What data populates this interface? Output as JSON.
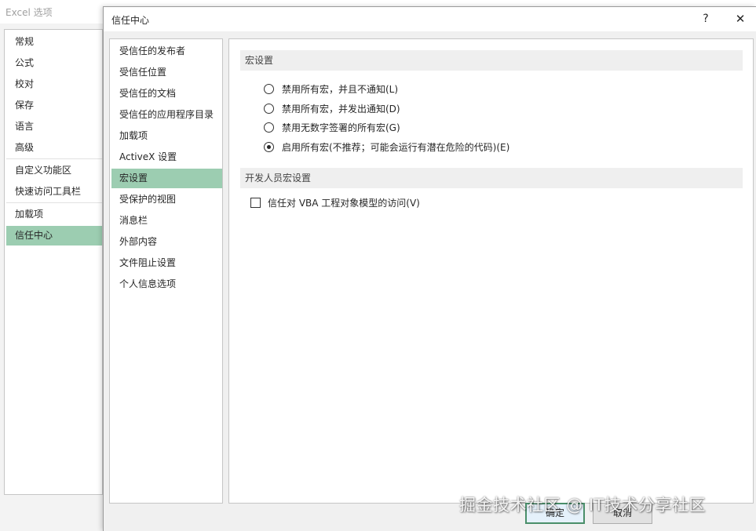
{
  "background_window": {
    "title": "Excel 选项",
    "sidebar_items": [
      {
        "label": "常规",
        "active": false
      },
      {
        "label": "公式",
        "active": false
      },
      {
        "label": "校对",
        "active": false
      },
      {
        "label": "保存",
        "active": false
      },
      {
        "label": "语言",
        "active": false
      },
      {
        "label": "高级",
        "active": false
      },
      {
        "label": "自定义功能区",
        "active": false
      },
      {
        "label": "快速访问工具栏",
        "active": false
      },
      {
        "label": "加载项",
        "active": false
      },
      {
        "label": "信任中心",
        "active": true
      }
    ]
  },
  "dialog": {
    "title": "信任中心",
    "help_label": "?",
    "close_label": "✕",
    "nav_items": [
      {
        "label": "受信任的发布者",
        "active": false
      },
      {
        "label": "受信任位置",
        "active": false
      },
      {
        "label": "受信任的文档",
        "active": false
      },
      {
        "label": "受信任的应用程序目录",
        "active": false
      },
      {
        "label": "加载项",
        "active": false
      },
      {
        "label": "ActiveX 设置",
        "active": false
      },
      {
        "label": "宏设置",
        "active": true
      },
      {
        "label": "受保护的视图",
        "active": false
      },
      {
        "label": "消息栏",
        "active": false
      },
      {
        "label": "外部内容",
        "active": false
      },
      {
        "label": "文件阻止设置",
        "active": false
      },
      {
        "label": "个人信息选项",
        "active": false
      }
    ],
    "macro_section": {
      "title": "宏设置",
      "options": [
        {
          "label": "禁用所有宏，并且不通知(L)",
          "checked": false
        },
        {
          "label": "禁用所有宏，并发出通知(D)",
          "checked": false
        },
        {
          "label": "禁用无数字签署的所有宏(G)",
          "checked": false
        },
        {
          "label": "启用所有宏(不推荐；可能会运行有潜在危险的代码)(E)",
          "checked": true
        }
      ]
    },
    "developer_section": {
      "title": "开发人员宏设置",
      "vba_access_label": "信任对 VBA 工程对象模型的访问(V)",
      "vba_access_checked": false
    },
    "ok_label": "确定",
    "cancel_label": "取消"
  },
  "watermark": "掘金技术社区 @ IT技术分享社区",
  "colors": {
    "selection": "#9ccdb1",
    "section_header_bg": "#efefef",
    "ok_border": "#4a8f6a"
  }
}
